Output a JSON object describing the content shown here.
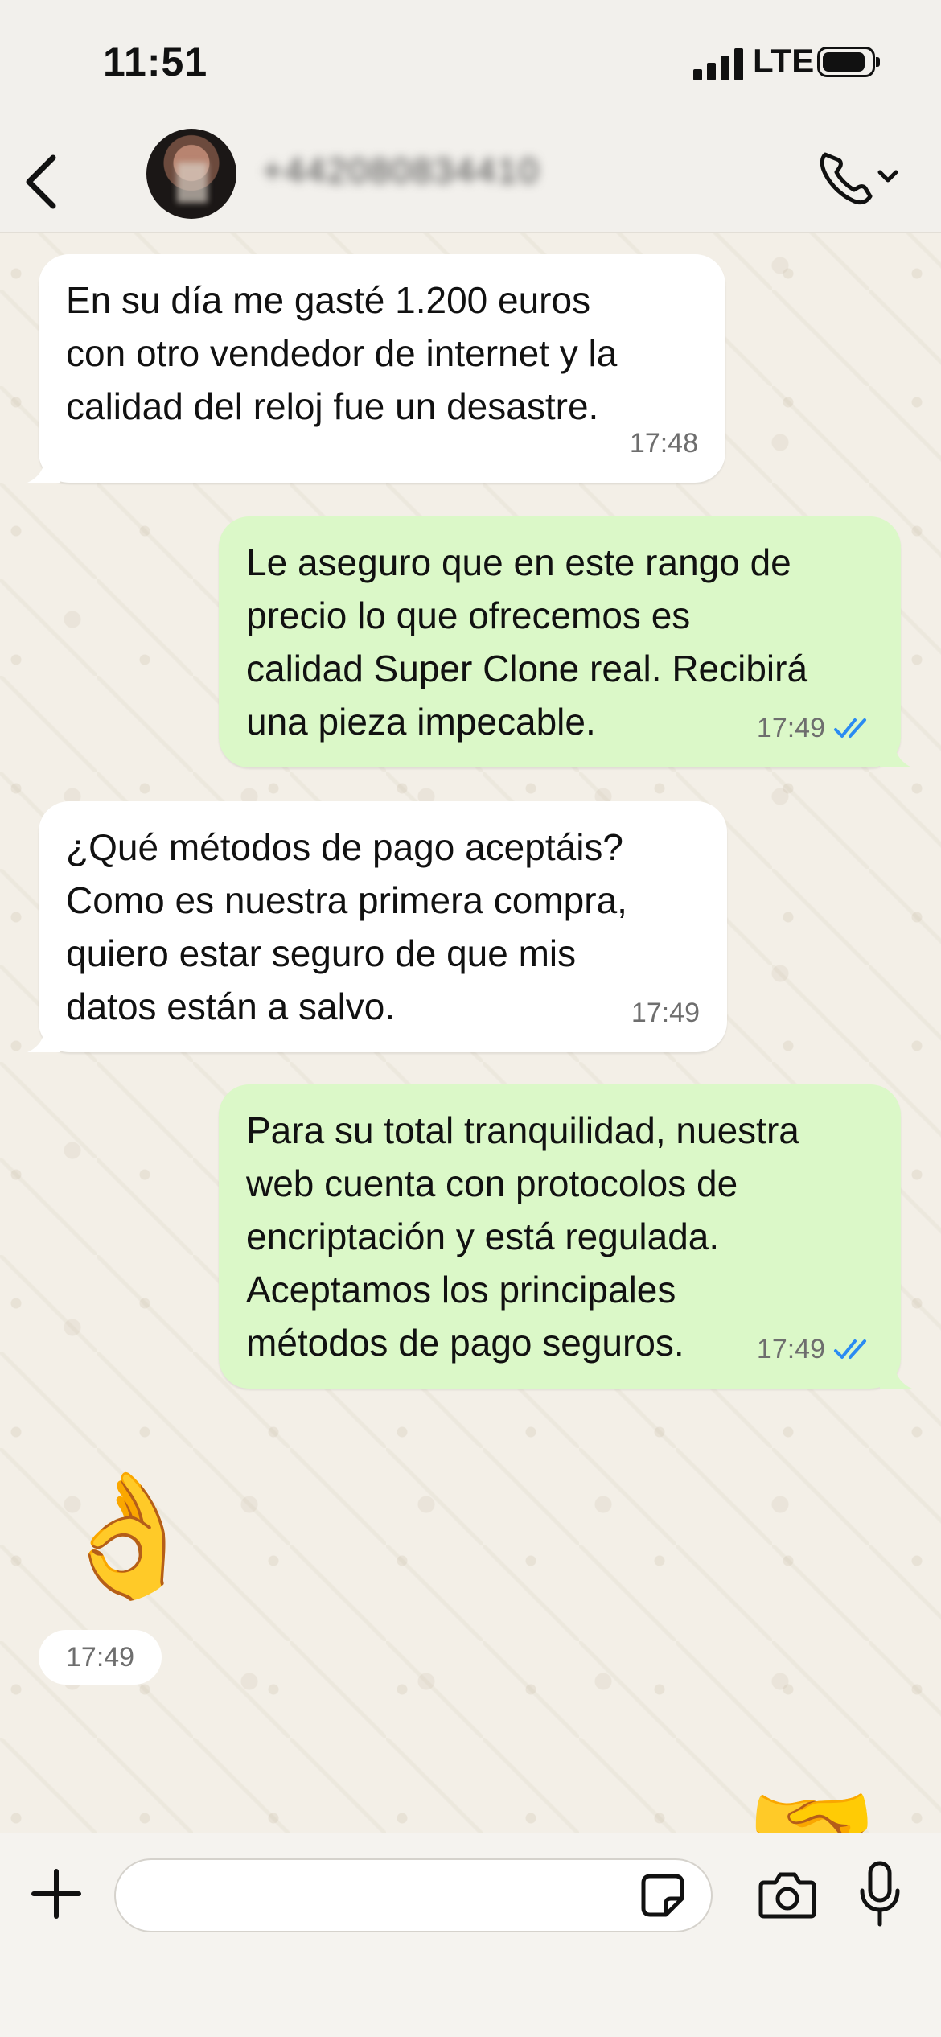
{
  "status_bar": {
    "time": "11:51",
    "network": "LTE"
  },
  "header": {
    "contact_name": "+442080834410"
  },
  "messages": [
    {
      "direction": "in",
      "text": "En su día me gasté 1.200 euros\ncon otro vendedor de internet y la\ncalidad del reloj fue un desastre.",
      "time": "17:48"
    },
    {
      "direction": "out",
      "text": "Le aseguro que en este rango de\nprecio lo que ofrecemos es\ncalidad Super Clone real. Recibirá\nuna pieza impecable.",
      "time": "17:49",
      "read": true
    },
    {
      "direction": "in",
      "text": "¿Qué métodos de pago aceptáis?\nComo es nuestra primera compra,\nquiero estar seguro de que mis\ndatos están a salvo.",
      "time": "17:49"
    },
    {
      "direction": "out",
      "text": "Para su total tranquilidad, nuestra\nweb cuenta con protocolos de\nencriptación y está regulada.\nAceptamos los principales\nmétodos de pago seguros.",
      "time": "17:49",
      "read": true
    },
    {
      "direction": "in",
      "emoji": "👌",
      "time": "17:49"
    },
    {
      "direction": "out",
      "emoji": "🤝"
    }
  ],
  "composer": {
    "value": "",
    "placeholder": ""
  },
  "colors": {
    "incoming": "#ffffff",
    "outgoing": "#dbf8c8",
    "read_ticks": "#2a8bf2",
    "background": "#f3efe7"
  }
}
